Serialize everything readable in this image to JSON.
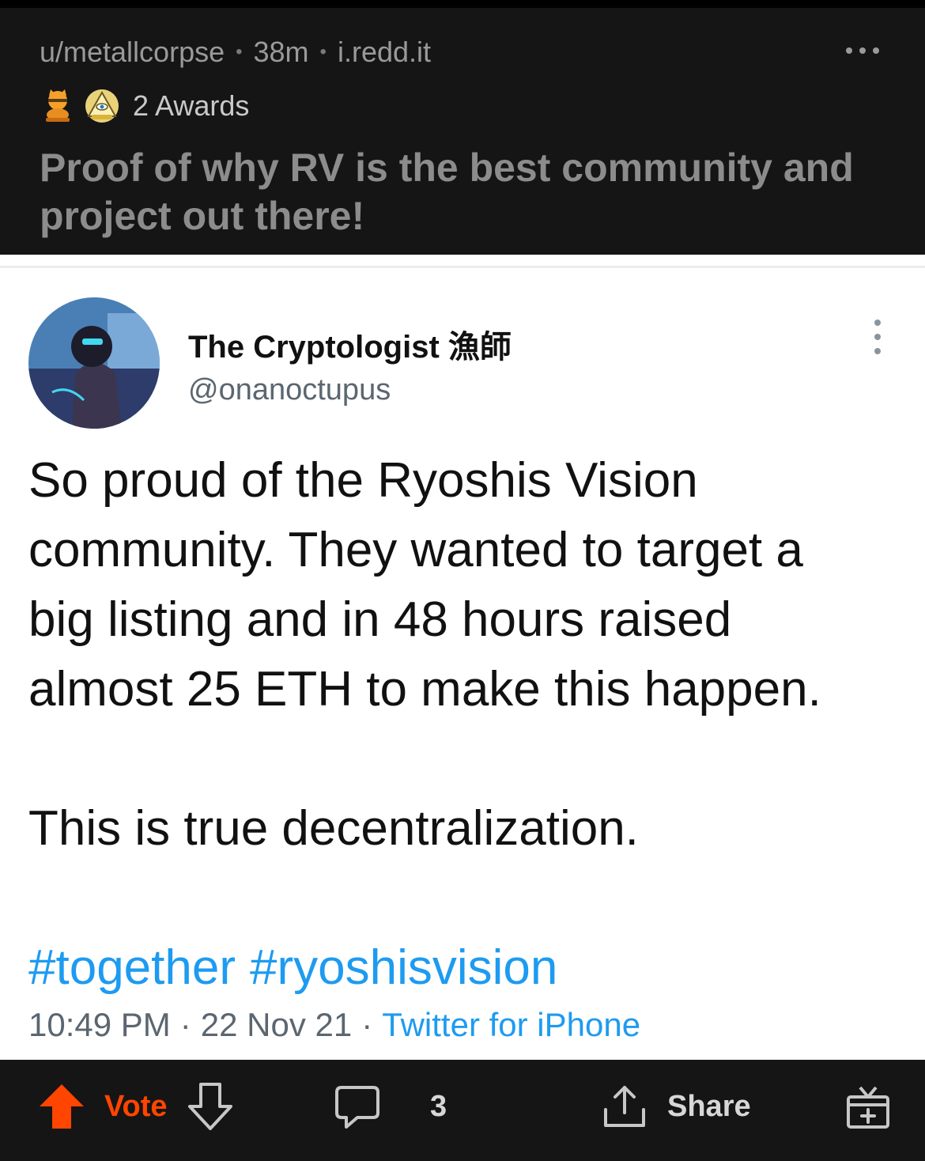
{
  "post": {
    "author": "u/metallcorpse",
    "age": "38m",
    "domain": "i.redd.it",
    "awards_label": "2 Awards",
    "title": "Proof of why RV is the best community and project out there!"
  },
  "tweet": {
    "display_name": "The Cryptologist 漁師",
    "handle": "@onanoctupus",
    "lines": [
      "So proud of the Ryoshis Vision",
      "community. They wanted to target a",
      "big listing and in 48 hours raised",
      "almost 25 ETH to make this happen."
    ],
    "second_paragraph": "This is true decentralization.",
    "hashtags": [
      "#together",
      "#ryoshisvision"
    ],
    "time": "10:49 PM",
    "date": "22 Nov 21",
    "source": "Twitter for iPhone"
  },
  "actions": {
    "vote_label": "Vote",
    "comment_count": "3",
    "share_label": "Share"
  },
  "colors": {
    "upvote": "#ff4500",
    "link": "#1d9bf0",
    "header_bg": "#151515"
  }
}
